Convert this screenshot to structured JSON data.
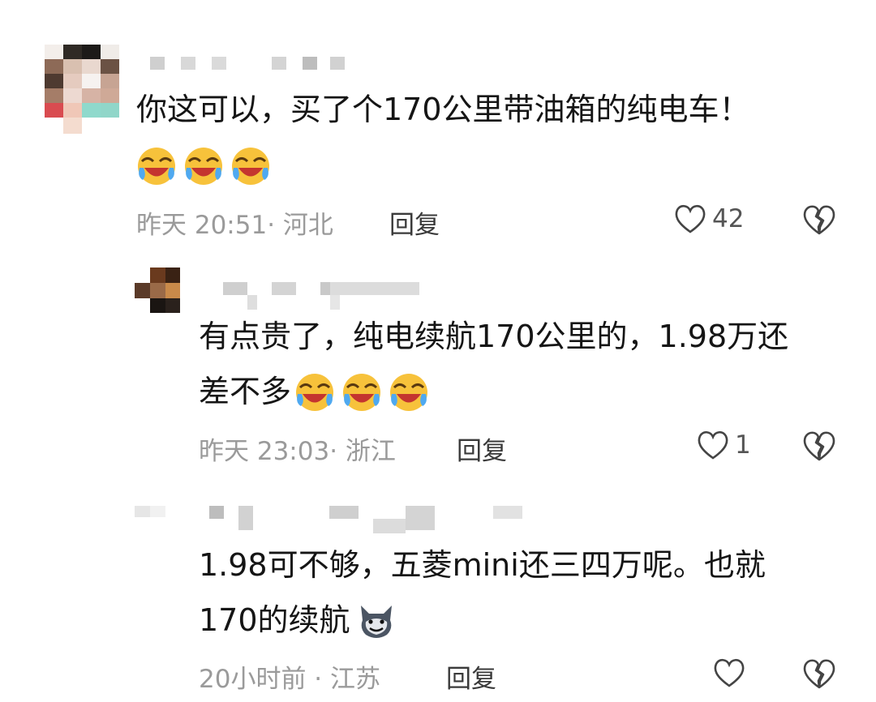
{
  "comments": [
    {
      "text": "你这可以，买了个170公里带油箱的纯电车！",
      "emojis": [
        "laughing-crying-emoji",
        "laughing-crying-emoji",
        "laughing-crying-emoji"
      ],
      "time_loc": "昨天 20:51· 河北",
      "reply_label": "回复",
      "likes": "42"
    },
    {
      "text_line1": "有点贵了，纯电续航170公里的，1.98万还",
      "text_line2": "差不多",
      "emojis": [
        "laughing-crying-emoji",
        "laughing-crying-emoji",
        "laughing-crying-emoji"
      ],
      "time_loc": "昨天 23:03· 浙江",
      "reply_label": "回复",
      "likes": "1"
    },
    {
      "text_line1": "1.98可不够，五菱mini还三四万呢。也就",
      "text_line2": "170的续航",
      "emojis": [
        "wolf-grin-emoji"
      ],
      "time_loc": "20小时前 · 江苏",
      "reply_label": "回复",
      "likes": ""
    }
  ]
}
